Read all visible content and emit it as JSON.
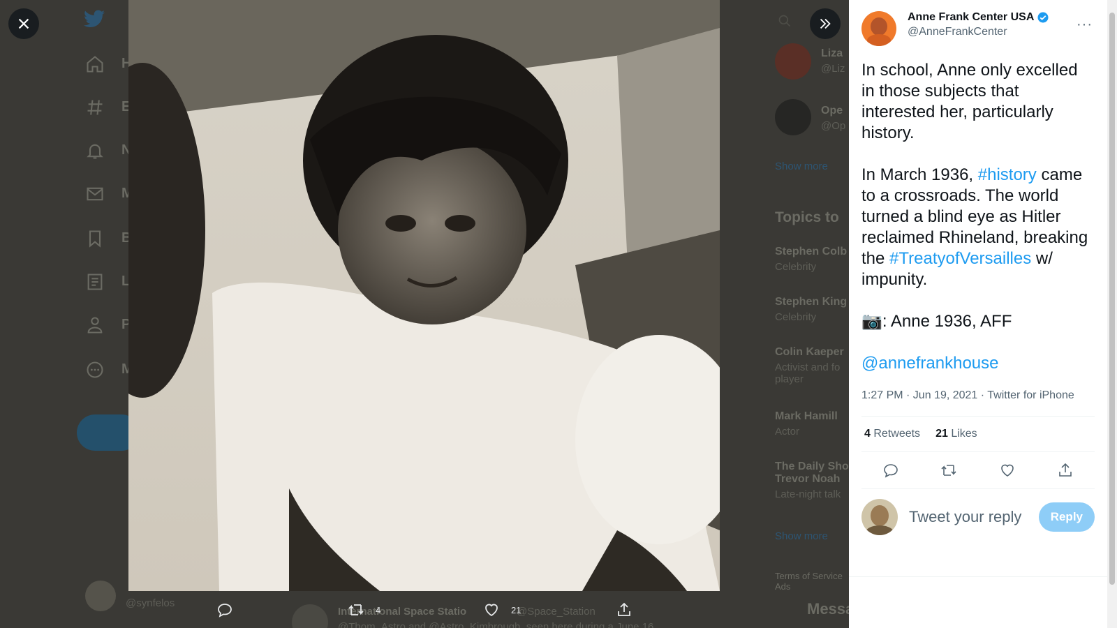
{
  "background": {
    "nav_labels": [
      "H",
      "E",
      "N",
      "M",
      "B",
      "L",
      "P",
      "M"
    ],
    "right_items": [
      {
        "name": "Liza",
        "sub": "@Liz"
      },
      {
        "name": "Ope",
        "sub": "@Op"
      }
    ],
    "show_more_1": "Show more",
    "topics_title": "Topics to",
    "topics": [
      {
        "name": "Stephen Colb",
        "sub": "Celebrity"
      },
      {
        "name": "Stephen King",
        "sub": "Celebrity"
      },
      {
        "name": "Colin Kaeper",
        "sub": "Activist and fo player"
      },
      {
        "name": "Mark Hamill",
        "sub": "Actor"
      },
      {
        "name": "The Daily Sho Trevor Noah",
        "sub": "Late-night talk"
      }
    ],
    "show_more_2": "Show more",
    "footer_links": "Terms of Service Ads",
    "messages_label": "Messa",
    "bottom_user": "@synfelos",
    "bottom_tweet_author": "International Space Statio",
    "bottom_tweet_handle": "@Space_Station",
    "bottom_tweet_text": "@Thom_Astro and @Astro_Kimbrough, seen here during a June 16"
  },
  "media_actions": {
    "retweets": "4",
    "likes": "21"
  },
  "tweet": {
    "author_name": "Anne Frank Center USA",
    "author_handle": "@AnneFrankCenter",
    "para1": "In school, Anne only excelled in those subjects that interested her, particularly history.",
    "para2_a": "In March 1936, ",
    "para2_tag1": "#history",
    "para2_b": " came to a crossroads. The world turned a blind eye as Hitler reclaimed Rhineland, breaking the ",
    "para2_tag2": "#TreatyofVersailles",
    "para2_c": " w/ impunity.",
    "para3_emoji": "📷",
    "para3_text": ": Anne 1936, AFF",
    "mention": "@annefrankhouse",
    "meta": "1:27 PM · Jun 19, 2021 · Twitter for iPhone",
    "retweet_count": "4",
    "retweet_label": "Retweets",
    "like_count": "21",
    "like_label": "Likes",
    "reply_placeholder": "Tweet your reply",
    "reply_button": "Reply"
  },
  "colors": {
    "accent": "#1d9bf0",
    "reply_button": "#8ecdf7"
  },
  "icons": [
    "close-icon",
    "expand-icon",
    "reply-icon",
    "retweet-icon",
    "like-icon",
    "share-icon",
    "verified-icon",
    "more-icon"
  ]
}
